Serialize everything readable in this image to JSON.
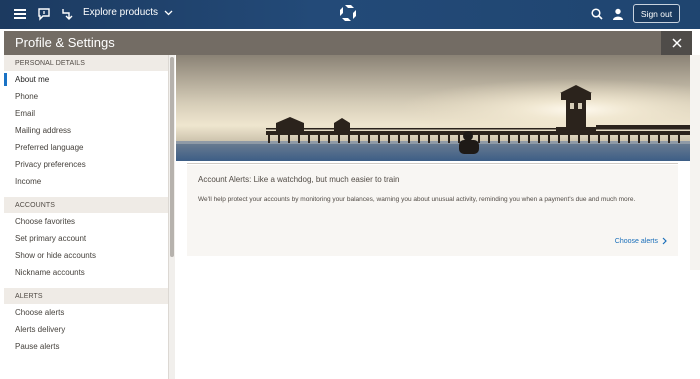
{
  "nav": {
    "explore_label": "Explore products",
    "signout_label": "Sign out"
  },
  "header": {
    "title": "Profile & Settings"
  },
  "sidebar": {
    "sections": [
      {
        "heading": "PERSONAL DETAILS",
        "items": [
          "About me",
          "Phone",
          "Email",
          "Mailing address",
          "Preferred language",
          "Privacy preferences",
          "Income"
        ]
      },
      {
        "heading": "ACCOUNTS",
        "items": [
          "Choose favorites",
          "Set primary account",
          "Show or hide accounts",
          "Nickname accounts"
        ]
      },
      {
        "heading": "ALERTS",
        "items": [
          "Choose alerts",
          "Alerts delivery",
          "Pause alerts"
        ]
      }
    ],
    "active_item": "About me"
  },
  "card": {
    "title": "Account Alerts: Like a watchdog, but much easier to train",
    "text": "We'll help protect your accounts by monitoring your balances, warning you about unusual activity, reminding you when a payment's due and much more.",
    "link_label": "Choose alerts"
  },
  "colors": {
    "nav_bg": "#1f4570",
    "header_bg": "#736c64",
    "accent": "#1a73c5",
    "link": "#1a6fba"
  },
  "icons": [
    "menu-icon",
    "chat-icon",
    "pin-icon",
    "chevron-down-icon",
    "logo-icon",
    "search-icon",
    "user-icon",
    "close-icon",
    "chevron-right-icon"
  ]
}
